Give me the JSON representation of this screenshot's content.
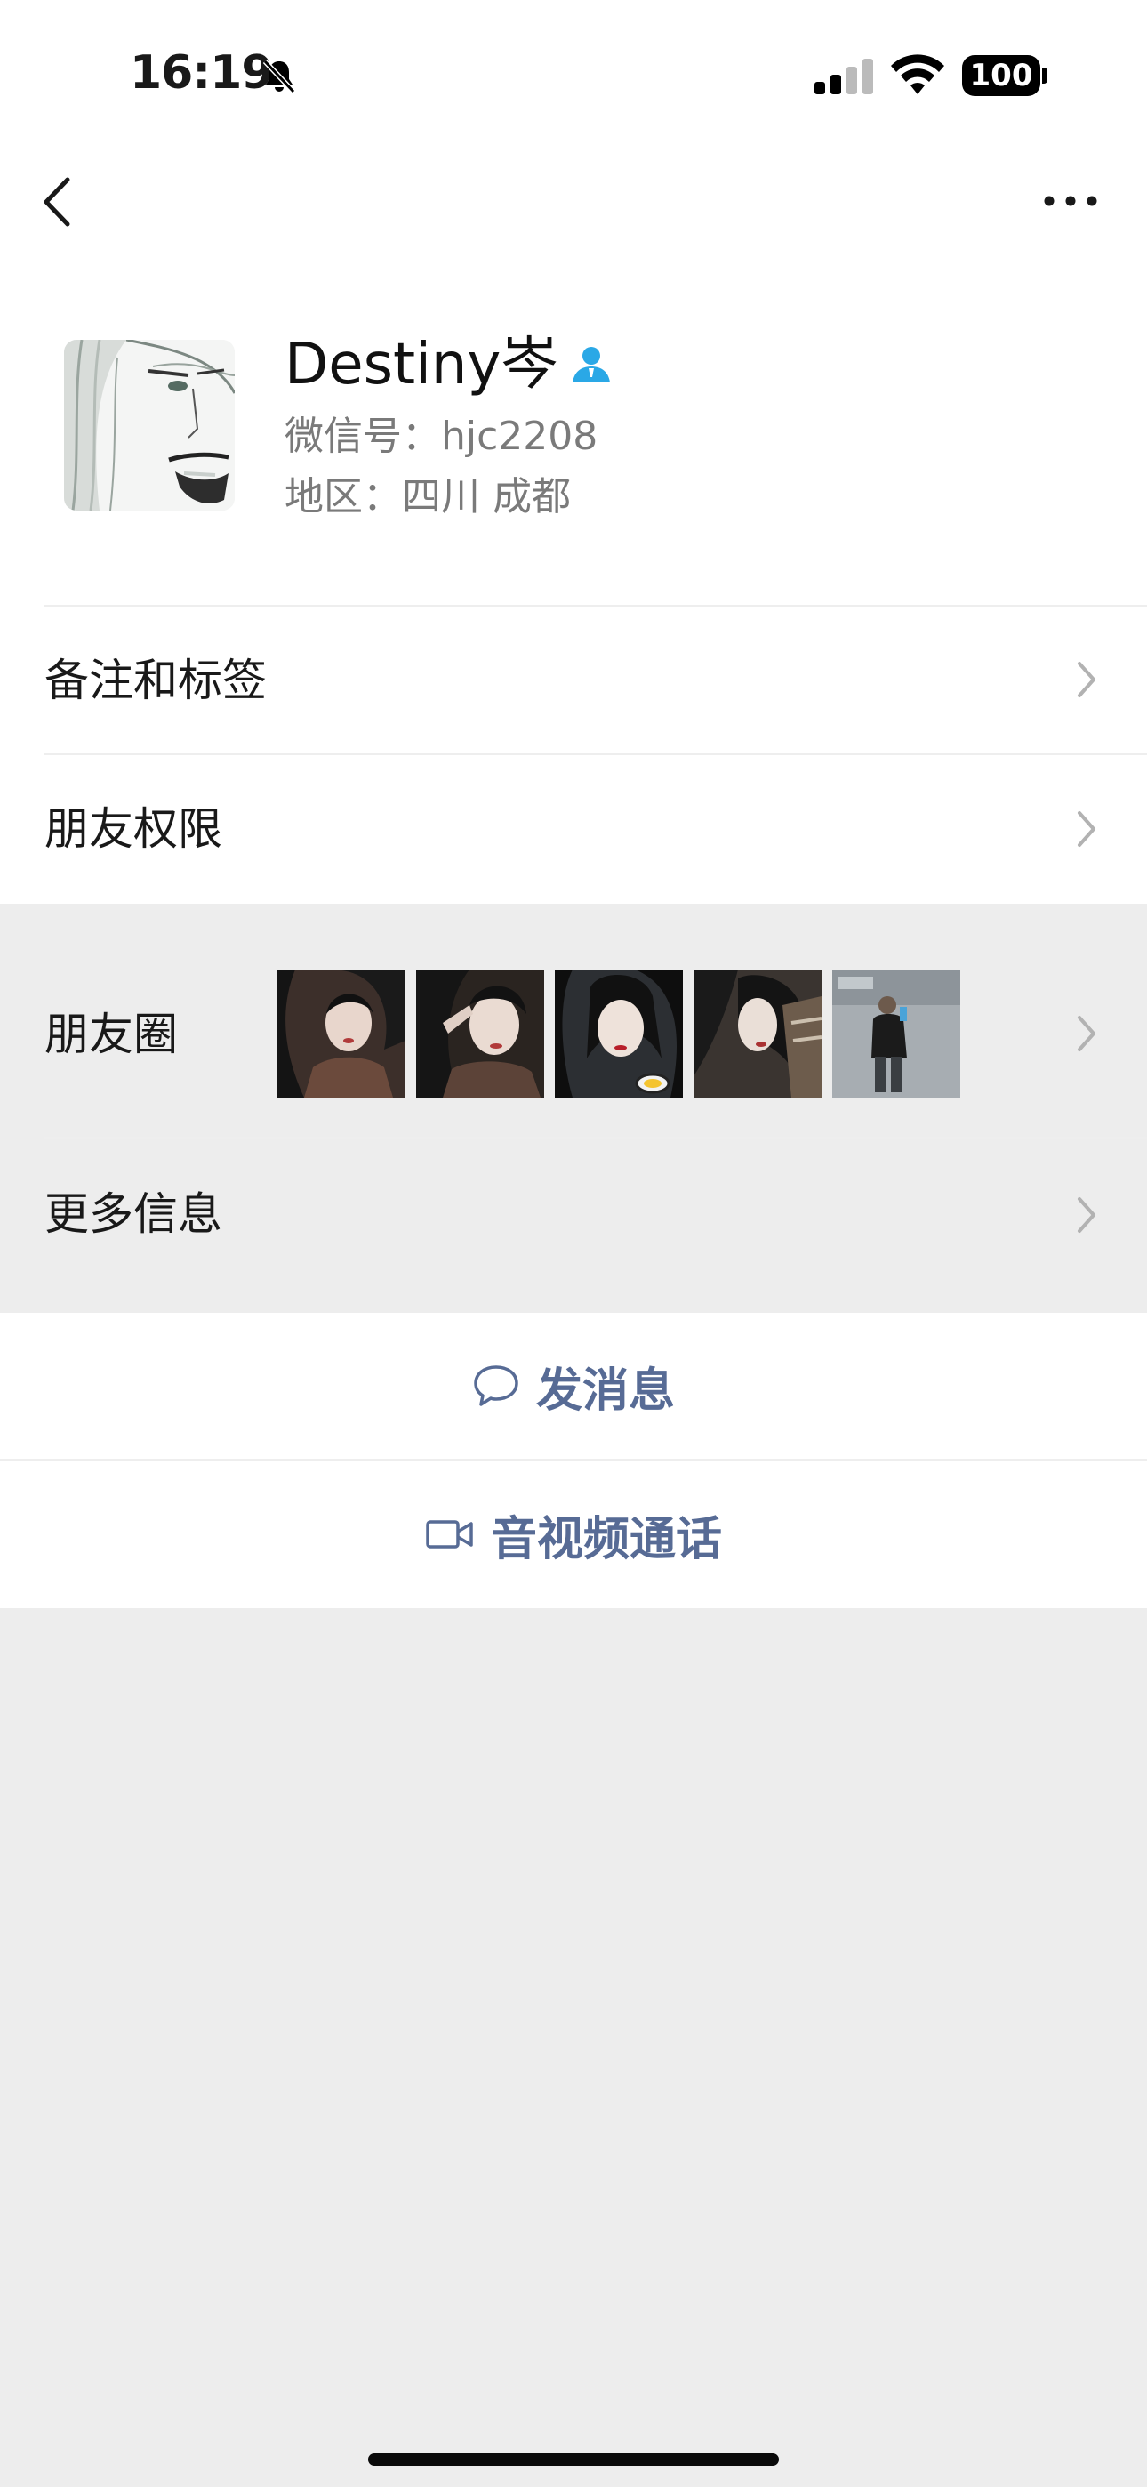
{
  "status_bar": {
    "time": "16:19",
    "battery": "100"
  },
  "profile": {
    "name": "Destiny岑",
    "wechat_id": "微信号：hjc2208",
    "region": "地区：四川 成都"
  },
  "menu": {
    "notes_tags": "备注和标签",
    "friend_permissions": "朋友权限",
    "moments": "朋友圈",
    "more_info": "更多信息"
  },
  "actions": {
    "send_message": "发消息",
    "voice_video_call": "音视频通话"
  },
  "colors": {
    "link_blue": "#576b95",
    "contact_icon": "#2aa8e6",
    "background": "#ededed"
  }
}
